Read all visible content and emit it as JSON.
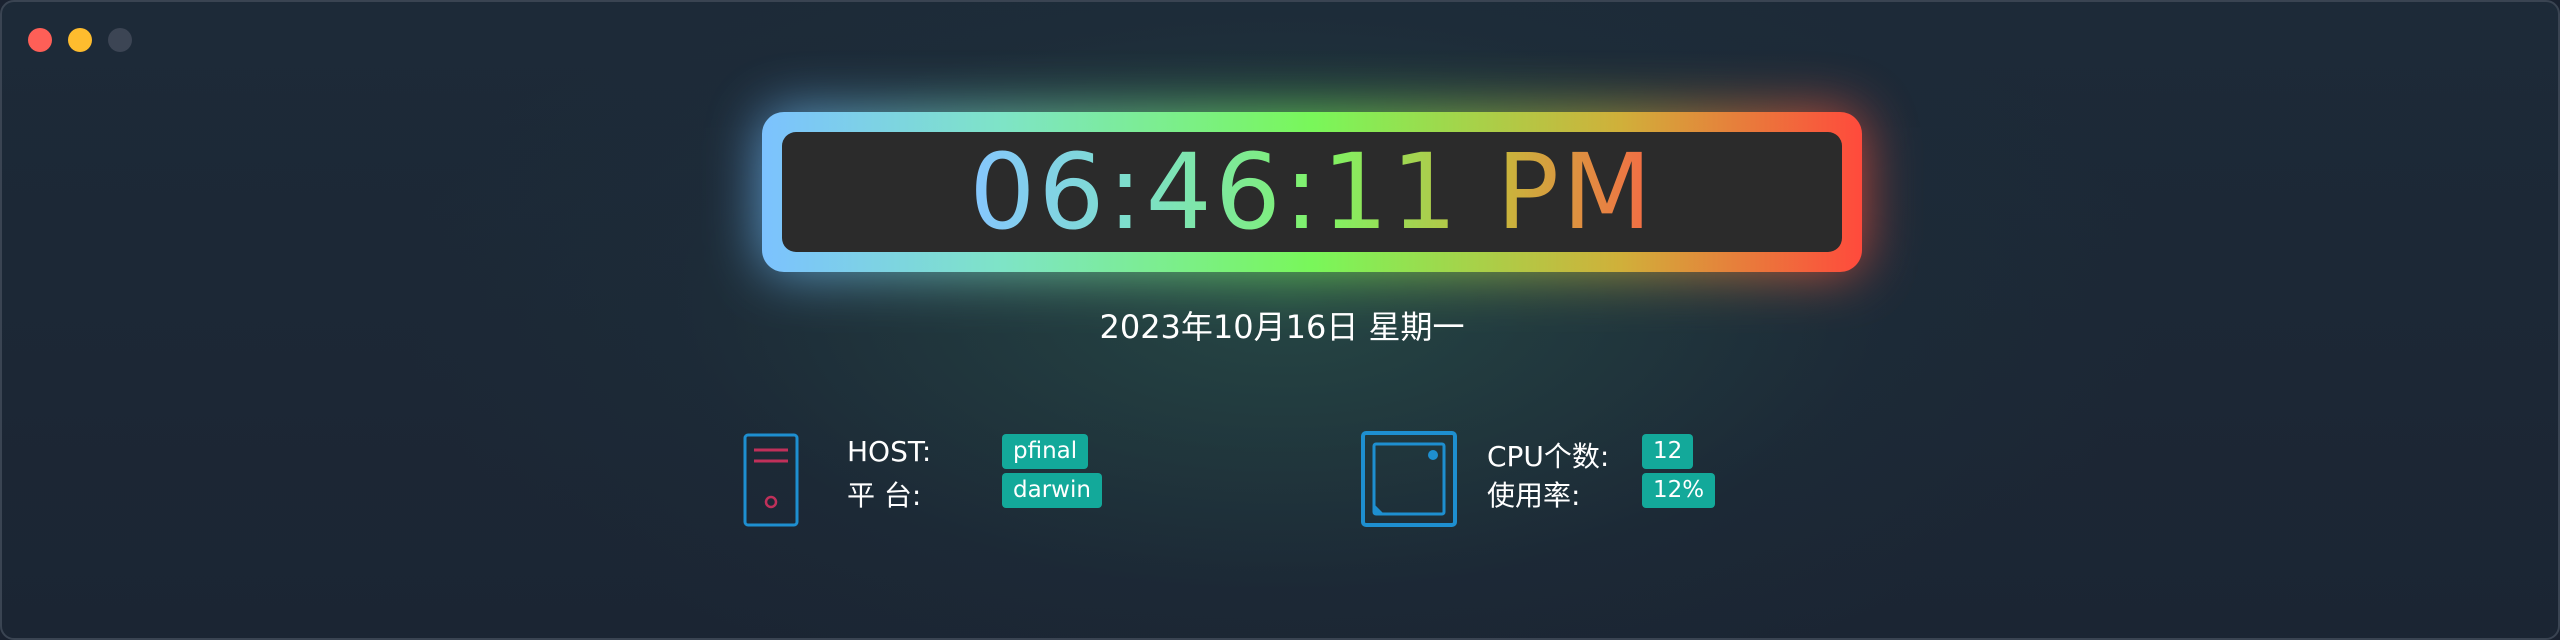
{
  "window": {
    "controls": [
      "close",
      "minimize",
      "zoom"
    ]
  },
  "clock": {
    "time": "06:46:11 PM"
  },
  "date": "2023年10月16日 星期一",
  "host_panel": {
    "icon": "server-tower-icon",
    "host_label": "HOST:",
    "host_value": "pfinal",
    "platform_label": "平 台:",
    "platform_value": "darwin"
  },
  "cpu_panel": {
    "icon": "cpu-chip-icon",
    "cores_label": "CPU个数:",
    "cores_value": "12",
    "usage_label": "使用率:",
    "usage_value": "12%"
  },
  "colors": {
    "background": "#1a2230",
    "badge": "#13a99a",
    "icon_blue": "#1e8fd0",
    "icon_red": "#c0305a",
    "close": "#fe5f57",
    "minimize": "#febc2e",
    "zoom_inactive": "#3c4554"
  }
}
